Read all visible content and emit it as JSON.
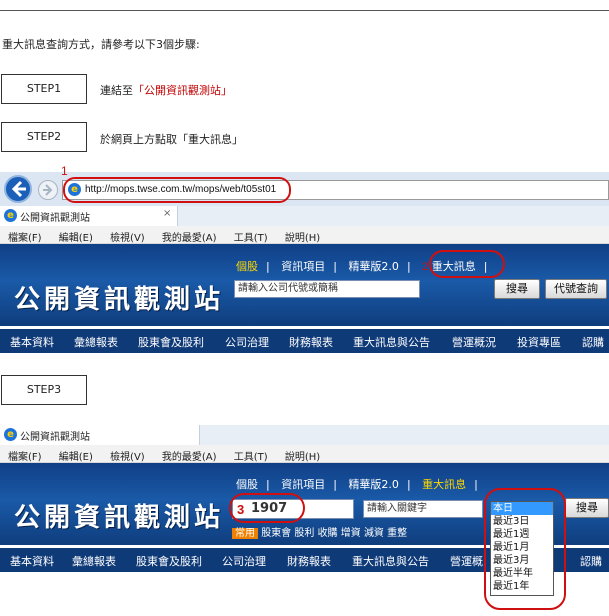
{
  "intro": "重大訊息查詢方式，請參考以下3個步驟:",
  "steps": [
    {
      "label": "STEP1",
      "desc_prefix": "連結至",
      "desc_link": "「公開資訊觀測站」"
    },
    {
      "label": "STEP2",
      "desc": "於網頁上方點取「重大訊息」"
    },
    {
      "label": "STEP3"
    }
  ],
  "browser": {
    "url": "http://mops.twse.com.tw/mops/web/t05st01",
    "marker1": "1",
    "tab_title": "公開資訊觀測站",
    "tab_close": "×",
    "menu": [
      "檔案(F)",
      "編輯(E)",
      "檢視(V)",
      "我的最愛(A)",
      "工具(T)",
      "說明(H)"
    ]
  },
  "site1": {
    "logo": "公開資訊觀測站",
    "links": [
      "個股",
      "資訊項目",
      "精華版2.0"
    ],
    "marker2": "2",
    "highlight_link": "重大訊息",
    "search_placeholder": "請輸入公司代號或簡稱",
    "search_btn": "搜尋",
    "code_btn": "代號查詢",
    "nav": [
      "基本資料",
      "彙總報表",
      "股東會及股利",
      "公司治理",
      "財務報表",
      "重大訊息與公告",
      "營運概況",
      "投資專區",
      "認購"
    ]
  },
  "site2": {
    "logo": "公開資訊觀測站",
    "links": [
      "個股",
      "資訊項目",
      "精華版2.0"
    ],
    "highlight_link": "重大訊息",
    "marker3": "3",
    "code_value": "1907",
    "keyword_placeholder": "請輸入關鍵字",
    "search_btn": "搜尋",
    "tags": [
      "常用",
      "股東會",
      "股利",
      "收購",
      "增資",
      "減資",
      "重整"
    ],
    "dropdown_options": [
      "本日",
      "最近3日",
      "最近1週",
      "最近1月",
      "最近3月",
      "最近半年",
      "最近1年"
    ],
    "nav": [
      "基本資料",
      "彙總報表",
      "股東會及股利",
      "公司治理",
      "財務報表",
      "重大訊息與公告",
      "營運概",
      "認購"
    ]
  },
  "colors": {
    "banner": "#1a5aa8",
    "nav": "#0f3a78",
    "highlight": "#d01010",
    "accent_yellow": "#ffd800"
  }
}
